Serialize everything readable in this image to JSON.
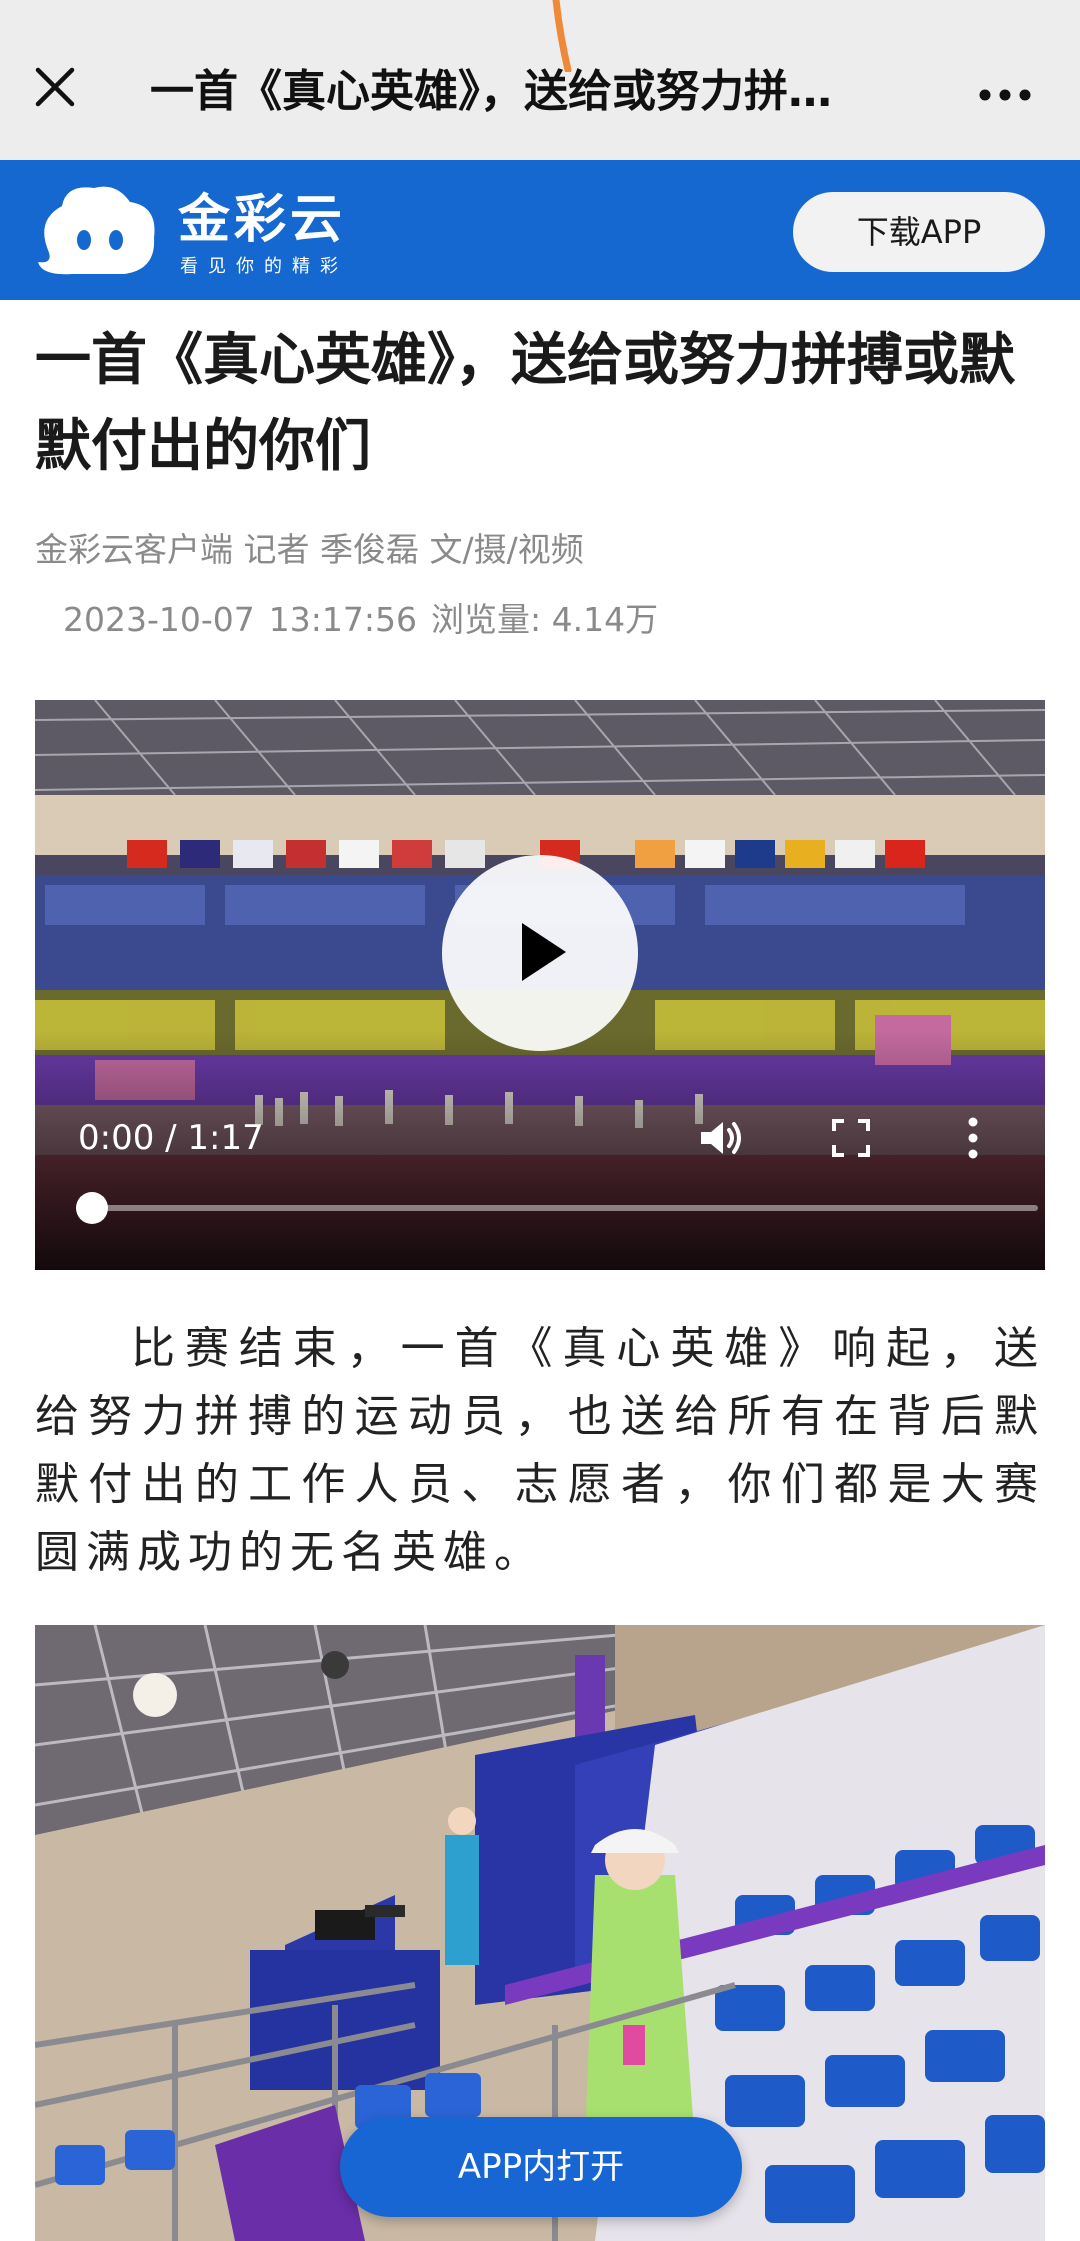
{
  "browser_bar": {
    "title": "一首《真心英雄》，送给或努力拼…",
    "close_icon": "close-icon",
    "more_icon": "more-dots-icon"
  },
  "brand": {
    "name": "金彩云",
    "slogan": "看见你的精彩",
    "download_label": "下载APP",
    "color": "#1568cf"
  },
  "article": {
    "headline": "一首《真心英雄》，送给或努力拼搏或默默付出的你们",
    "byline": "金彩云客户端  记者  季俊磊  文/摄/视频",
    "date": "2023-10-07",
    "time": "13:17:56",
    "views": "浏览量: 4.14万",
    "paragraph": "比赛结束，一首《真心英雄》响起，送给努力拼搏的运动员，也送给所有在背后默默付出的工作人员、志愿者，你们都是大赛圆满成功的无名英雄。"
  },
  "video": {
    "time_display": "0:00 / 1:17",
    "progress": 0,
    "play_icon": "play-icon",
    "volume_icon": "volume-icon",
    "fullscreen_icon": "fullscreen-icon",
    "menu_icon": "more-vertical-icon"
  },
  "floating": {
    "open_app_label": "APP内打开",
    "color": "#1766d4"
  }
}
